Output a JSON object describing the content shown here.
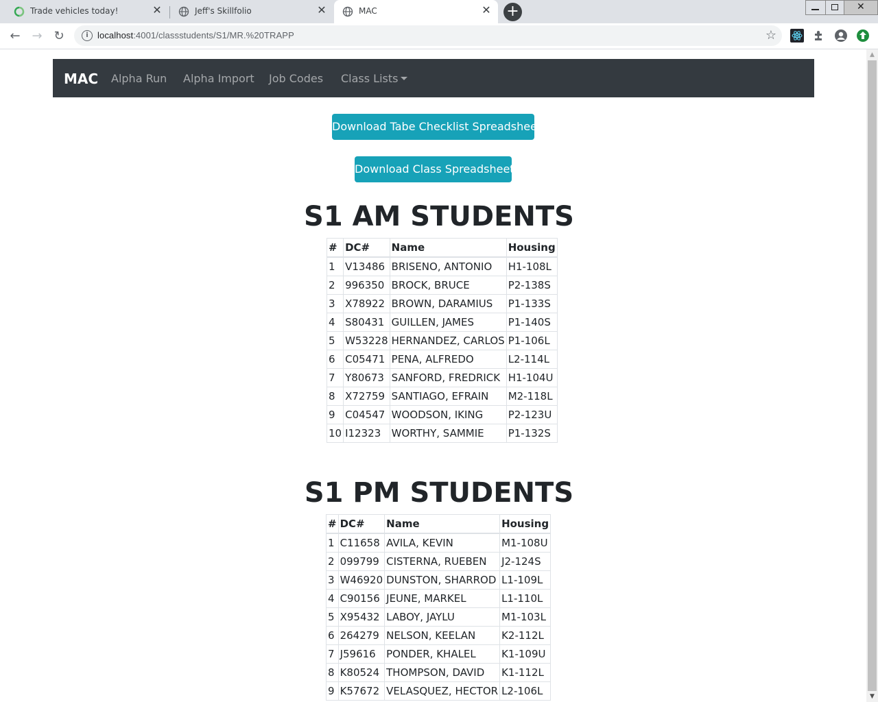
{
  "browser": {
    "tabs": [
      {
        "title": "Trade vehicles today!"
      },
      {
        "title": "Jeff's Skillfolio"
      },
      {
        "title": "MAC"
      }
    ],
    "url_host": "localhost",
    "url_rest": ":4001/classstudents/S1/MR.%20TRAPP"
  },
  "navbar": {
    "brand": "MAC",
    "links": [
      "Alpha Run",
      "Alpha Import",
      "Job Codes",
      "Class Lists"
    ]
  },
  "buttons": {
    "tabe": "Download Tabe Checklist Spreadsheet",
    "class": "Download Class Spreadsheet"
  },
  "am": {
    "title": "S1 AM STUDENTS",
    "headers": [
      "#",
      "DC#",
      "Name",
      "Housing"
    ],
    "rows": [
      [
        "1",
        "V13486",
        "BRISENO, ANTONIO",
        "H1-108L"
      ],
      [
        "2",
        "996350",
        "BROCK, BRUCE",
        "P2-138S"
      ],
      [
        "3",
        "X78922",
        "BROWN, DARAMIUS",
        "P1-133S"
      ],
      [
        "4",
        "S80431",
        "GUILLEN, JAMES",
        "P1-140S"
      ],
      [
        "5",
        "W53228",
        "HERNANDEZ, CARLOS",
        "P1-106L"
      ],
      [
        "6",
        "C05471",
        "PENA, ALFREDO",
        "L2-114L"
      ],
      [
        "7",
        "Y80673",
        "SANFORD, FREDRICK",
        "H1-104U"
      ],
      [
        "8",
        "X72759",
        "SANTIAGO, EFRAIN",
        "M2-118L"
      ],
      [
        "9",
        "C04547",
        "WOODSON, IKING",
        "P2-123U"
      ],
      [
        "10",
        "I12323",
        "WORTHY, SAMMIE",
        "P1-132S"
      ]
    ]
  },
  "pm": {
    "title": "S1 PM STUDENTS",
    "headers": [
      "#",
      "DC#",
      "Name",
      "Housing"
    ],
    "rows": [
      [
        "1",
        "C11658",
        "AVILA, KEVIN",
        "M1-108U"
      ],
      [
        "2",
        "099799",
        "CISTERNA, RUEBEN",
        "J2-124S"
      ],
      [
        "3",
        "W46920",
        "DUNSTON, SHARROD",
        "L1-109L"
      ],
      [
        "4",
        "C90156",
        "JEUNE, MARKEL",
        "L1-110L"
      ],
      [
        "5",
        "X95432",
        "LABOY, JAYLU",
        "M1-103L"
      ],
      [
        "6",
        "264279",
        "NELSON, KEELAN",
        "K2-112L"
      ],
      [
        "7",
        "J59616",
        "PONDER, KHALEL",
        "K1-109U"
      ],
      [
        "8",
        "K80524",
        "THOMPSON, DAVID",
        "K1-112L"
      ],
      [
        "9",
        "K57672",
        "VELASQUEZ, HECTOR",
        "L2-106L"
      ]
    ]
  }
}
